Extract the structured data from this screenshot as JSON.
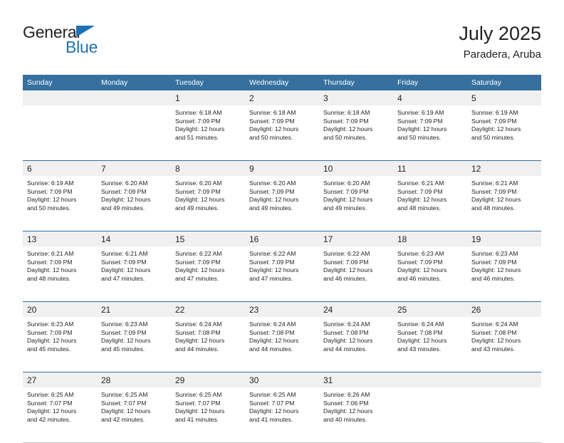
{
  "brand": {
    "name_top": "General",
    "name_bottom": "Blue",
    "accent_color": "#1b72b8"
  },
  "header": {
    "title": "July 2025",
    "subtitle": "Paradera, Aruba"
  },
  "theme": {
    "header_blue": "#35709f",
    "daynum_band": "#f0f0f0",
    "text": "#231f20"
  },
  "weekdays": [
    "Sunday",
    "Monday",
    "Tuesday",
    "Wednesday",
    "Thursday",
    "Friday",
    "Saturday"
  ],
  "weeks": [
    [
      {
        "day": "",
        "lines": []
      },
      {
        "day": "",
        "lines": []
      },
      {
        "day": "1",
        "lines": [
          "Sunrise: 6:18 AM",
          "Sunset: 7:09 PM",
          "Daylight: 12 hours",
          "and 51 minutes."
        ]
      },
      {
        "day": "2",
        "lines": [
          "Sunrise: 6:18 AM",
          "Sunset: 7:09 PM",
          "Daylight: 12 hours",
          "and 50 minutes."
        ]
      },
      {
        "day": "3",
        "lines": [
          "Sunrise: 6:18 AM",
          "Sunset: 7:09 PM",
          "Daylight: 12 hours",
          "and 50 minutes."
        ]
      },
      {
        "day": "4",
        "lines": [
          "Sunrise: 6:19 AM",
          "Sunset: 7:09 PM",
          "Daylight: 12 hours",
          "and 50 minutes."
        ]
      },
      {
        "day": "5",
        "lines": [
          "Sunrise: 6:19 AM",
          "Sunset: 7:09 PM",
          "Daylight: 12 hours",
          "and 50 minutes."
        ]
      }
    ],
    [
      {
        "day": "6",
        "lines": [
          "Sunrise: 6:19 AM",
          "Sunset: 7:09 PM",
          "Daylight: 12 hours",
          "and 50 minutes."
        ]
      },
      {
        "day": "7",
        "lines": [
          "Sunrise: 6:20 AM",
          "Sunset: 7:09 PM",
          "Daylight: 12 hours",
          "and 49 minutes."
        ]
      },
      {
        "day": "8",
        "lines": [
          "Sunrise: 6:20 AM",
          "Sunset: 7:09 PM",
          "Daylight: 12 hours",
          "and 49 minutes."
        ]
      },
      {
        "day": "9",
        "lines": [
          "Sunrise: 6:20 AM",
          "Sunset: 7:09 PM",
          "Daylight: 12 hours",
          "and 49 minutes."
        ]
      },
      {
        "day": "10",
        "lines": [
          "Sunrise: 6:20 AM",
          "Sunset: 7:09 PM",
          "Daylight: 12 hours",
          "and 49 minutes."
        ]
      },
      {
        "day": "11",
        "lines": [
          "Sunrise: 6:21 AM",
          "Sunset: 7:09 PM",
          "Daylight: 12 hours",
          "and 48 minutes."
        ]
      },
      {
        "day": "12",
        "lines": [
          "Sunrise: 6:21 AM",
          "Sunset: 7:09 PM",
          "Daylight: 12 hours",
          "and 48 minutes."
        ]
      }
    ],
    [
      {
        "day": "13",
        "lines": [
          "Sunrise: 6:21 AM",
          "Sunset: 7:09 PM",
          "Daylight: 12 hours",
          "and 48 minutes."
        ]
      },
      {
        "day": "14",
        "lines": [
          "Sunrise: 6:21 AM",
          "Sunset: 7:09 PM",
          "Daylight: 12 hours",
          "and 47 minutes."
        ]
      },
      {
        "day": "15",
        "lines": [
          "Sunrise: 6:22 AM",
          "Sunset: 7:09 PM",
          "Daylight: 12 hours",
          "and 47 minutes."
        ]
      },
      {
        "day": "16",
        "lines": [
          "Sunrise: 6:22 AM",
          "Sunset: 7:09 PM",
          "Daylight: 12 hours",
          "and 47 minutes."
        ]
      },
      {
        "day": "17",
        "lines": [
          "Sunrise: 6:22 AM",
          "Sunset: 7:09 PM",
          "Daylight: 12 hours",
          "and 46 minutes."
        ]
      },
      {
        "day": "18",
        "lines": [
          "Sunrise: 6:23 AM",
          "Sunset: 7:09 PM",
          "Daylight: 12 hours",
          "and 46 minutes."
        ]
      },
      {
        "day": "19",
        "lines": [
          "Sunrise: 6:23 AM",
          "Sunset: 7:09 PM",
          "Daylight: 12 hours",
          "and 46 minutes."
        ]
      }
    ],
    [
      {
        "day": "20",
        "lines": [
          "Sunrise: 6:23 AM",
          "Sunset: 7:09 PM",
          "Daylight: 12 hours",
          "and 45 minutes."
        ]
      },
      {
        "day": "21",
        "lines": [
          "Sunrise: 6:23 AM",
          "Sunset: 7:09 PM",
          "Daylight: 12 hours",
          "and 45 minutes."
        ]
      },
      {
        "day": "22",
        "lines": [
          "Sunrise: 6:24 AM",
          "Sunset: 7:08 PM",
          "Daylight: 12 hours",
          "and 44 minutes."
        ]
      },
      {
        "day": "23",
        "lines": [
          "Sunrise: 6:24 AM",
          "Sunset: 7:08 PM",
          "Daylight: 12 hours",
          "and 44 minutes."
        ]
      },
      {
        "day": "24",
        "lines": [
          "Sunrise: 6:24 AM",
          "Sunset: 7:08 PM",
          "Daylight: 12 hours",
          "and 44 minutes."
        ]
      },
      {
        "day": "25",
        "lines": [
          "Sunrise: 6:24 AM",
          "Sunset: 7:08 PM",
          "Daylight: 12 hours",
          "and 43 minutes."
        ]
      },
      {
        "day": "26",
        "lines": [
          "Sunrise: 6:24 AM",
          "Sunset: 7:08 PM",
          "Daylight: 12 hours",
          "and 43 minutes."
        ]
      }
    ],
    [
      {
        "day": "27",
        "lines": [
          "Sunrise: 6:25 AM",
          "Sunset: 7:07 PM",
          "Daylight: 12 hours",
          "and 42 minutes."
        ]
      },
      {
        "day": "28",
        "lines": [
          "Sunrise: 6:25 AM",
          "Sunset: 7:07 PM",
          "Daylight: 12 hours",
          "and 42 minutes."
        ]
      },
      {
        "day": "29",
        "lines": [
          "Sunrise: 6:25 AM",
          "Sunset: 7:07 PM",
          "Daylight: 12 hours",
          "and 41 minutes."
        ]
      },
      {
        "day": "30",
        "lines": [
          "Sunrise: 6:25 AM",
          "Sunset: 7:07 PM",
          "Daylight: 12 hours",
          "and 41 minutes."
        ]
      },
      {
        "day": "31",
        "lines": [
          "Sunrise: 6:26 AM",
          "Sunset: 7:06 PM",
          "Daylight: 12 hours",
          "and 40 minutes."
        ]
      },
      {
        "day": "",
        "lines": []
      },
      {
        "day": "",
        "lines": []
      }
    ]
  ]
}
